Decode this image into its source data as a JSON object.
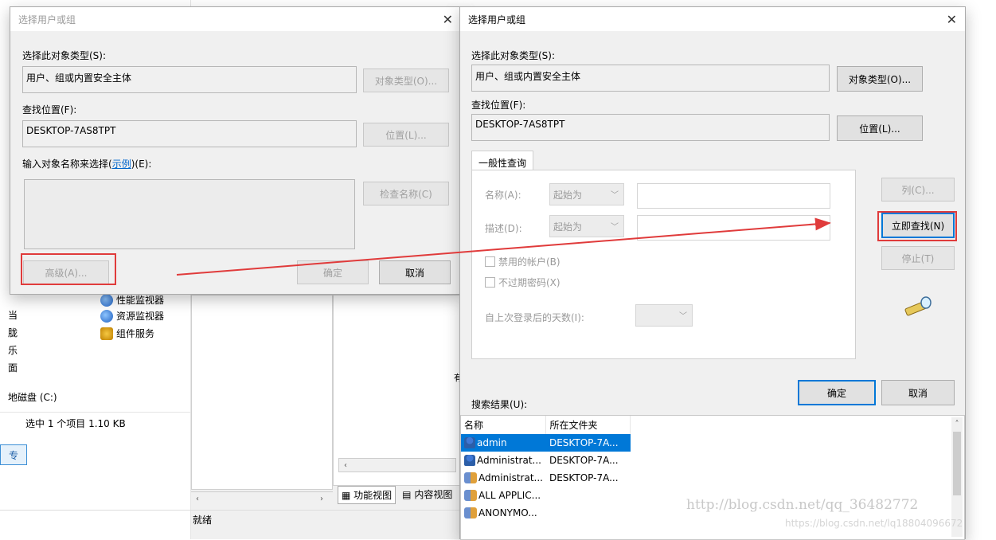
{
  "background": {
    "explorer": {
      "sidebar_letters": [
        "当",
        "胧",
        "乐",
        "面"
      ],
      "drive_label": "地磁盘 (C:)",
      "status": "选中 1 个项目  1.10 KB",
      "blue_button": "专"
    },
    "mmc": {
      "tree": [
        {
          "label": "性能监视器"
        },
        {
          "label": "资源监视器"
        },
        {
          "label": "组件服务"
        }
      ],
      "status": "就绪",
      "tab_function": "功能视图",
      "tab_content": "内容视图",
      "side_letter": "有"
    }
  },
  "dialog_left": {
    "title": "选择用户或组",
    "object_type_label": "选择此对象类型(S):",
    "object_type_value": "用户、组或内置安全主体",
    "object_type_button": "对象类型(O)...",
    "location_label": "查找位置(F):",
    "location_value": "DESKTOP-7AS8TPT",
    "location_button": "位置(L)...",
    "enter_label_prefix": "输入对象名称来选择(",
    "enter_label_link": "示例",
    "enter_label_suffix": ")(E):",
    "check_names_button": "检查名称(C)",
    "advanced_button": "高级(A)...",
    "ok_button": "确定",
    "cancel_button": "取消"
  },
  "dialog_right": {
    "title": "选择用户或组",
    "object_type_label": "选择此对象类型(S):",
    "object_type_value": "用户、组或内置安全主体",
    "object_type_button": "对象类型(O)...",
    "location_label": "查找位置(F):",
    "location_value": "DESKTOP-7AS8TPT",
    "location_button": "位置(L)...",
    "tab_label": "一般性查询",
    "name_label": "名称(A):",
    "name_combo": "起始为",
    "desc_label": "描述(D):",
    "desc_combo": "起始为",
    "disabled_accounts": "禁用的帐户(B)",
    "non_expiring": "不过期密码(X)",
    "days_label": "自上次登录后的天数(I):",
    "columns_button": "列(C)...",
    "find_now_button": "立即查找(N)",
    "stop_button": "停止(T)",
    "ok_button": "确定",
    "cancel_button": "取消",
    "results_label": "搜索结果(U):",
    "results_headers": [
      "名称",
      "所在文件夹"
    ],
    "results": [
      {
        "name": "admin",
        "folder": "DESKTOP-7A..."
      },
      {
        "name": "Administrat...",
        "folder": "DESKTOP-7A..."
      },
      {
        "name": "Administrat...",
        "folder": "DESKTOP-7A..."
      },
      {
        "name": "ALL APPLIC...",
        "folder": ""
      },
      {
        "name": "ANONYMO...",
        "folder": ""
      }
    ]
  },
  "watermark": {
    "line1": "http://blog.csdn.net/qq_36482772",
    "line2": "https://blog.csdn.net/lq18804096672"
  },
  "colors": {
    "highlight_red": "#e03b3b",
    "selection_blue": "#0078d7",
    "link_blue": "#0066cc"
  }
}
